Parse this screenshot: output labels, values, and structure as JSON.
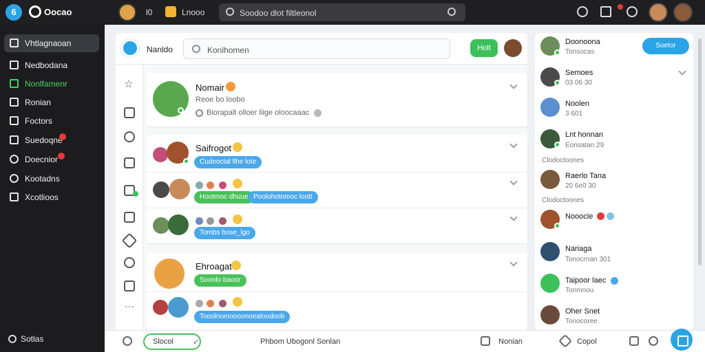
{
  "topbar": {
    "brand": "Oocao",
    "item1": "l0",
    "item2": "Lnooo",
    "search_text": "Soodoo dlot filtleonol"
  },
  "sidebar": {
    "items": [
      {
        "label": "Vhtlagnaoan",
        "active": true
      },
      {
        "label": "Nedbodana"
      },
      {
        "label": "Nonlfamenr",
        "highlight": true
      },
      {
        "label": "Ronian"
      },
      {
        "label": "Foctors"
      },
      {
        "label": "Suedoqne",
        "badge": true
      },
      {
        "label": "Doecnior",
        "badge": true
      },
      {
        "label": "Kootadns"
      },
      {
        "label": "Xcotlioos"
      }
    ],
    "bottom_label": "Sotlas"
  },
  "main": {
    "header_title": "Nanldo",
    "search_placeholder": "Konlhomen",
    "header_button": "Holt",
    "cards": [
      {
        "name": "Nomair",
        "sub1": "Reoe bo loobo",
        "sub2": "Biorapalt olloer liige oloocaaac"
      },
      {
        "name": "Saifrogot",
        "pill": "Cudeoctal llhe lote"
      },
      {
        "pill_green": "Hootmoc dhuue",
        "pill_blue": "Poolohotnmoc loott"
      },
      {
        "pill": "Tombs bose_lgo"
      },
      {
        "name": "Ehroagat",
        "pill": "Soonlo baoor"
      },
      {
        "pill": "Tooolnomoooonoealoodoob"
      }
    ]
  },
  "bottombar": {
    "input": "Slocol",
    "center": "Phbom Ubogonl Sonlan",
    "right1": "Nonian",
    "right2": "Copol"
  },
  "rpanel": {
    "button": "Soetor",
    "contacts": [
      {
        "name": "Doonoona",
        "sub": "Tonsocas"
      },
      {
        "name": "Semoes",
        "sub": "03 06 30"
      },
      {
        "name": "Noolen",
        "sub": "3 601"
      },
      {
        "name": "Lnt honnan",
        "sub": "Eonsatan  29"
      },
      {
        "name": "Raerlo Tana",
        "sub": "20 6e0 30"
      },
      {
        "name": "Nooocle",
        "sub": ""
      },
      {
        "name": "Nariaga",
        "sub": "Tonocrnan  301"
      },
      {
        "name": "Taipoor laec",
        "sub": "Tonmnou"
      },
      {
        "name": "Oher Snet",
        "sub": "Tonocoree"
      }
    ],
    "section1": "Clodoctoones",
    "section2": "Clodoctoones"
  },
  "colors": {
    "accent_blue": "#2aa4e6",
    "accent_green": "#3cc15a",
    "sidebar_bg": "#1c1c1f",
    "badge_red": "#e53935"
  }
}
